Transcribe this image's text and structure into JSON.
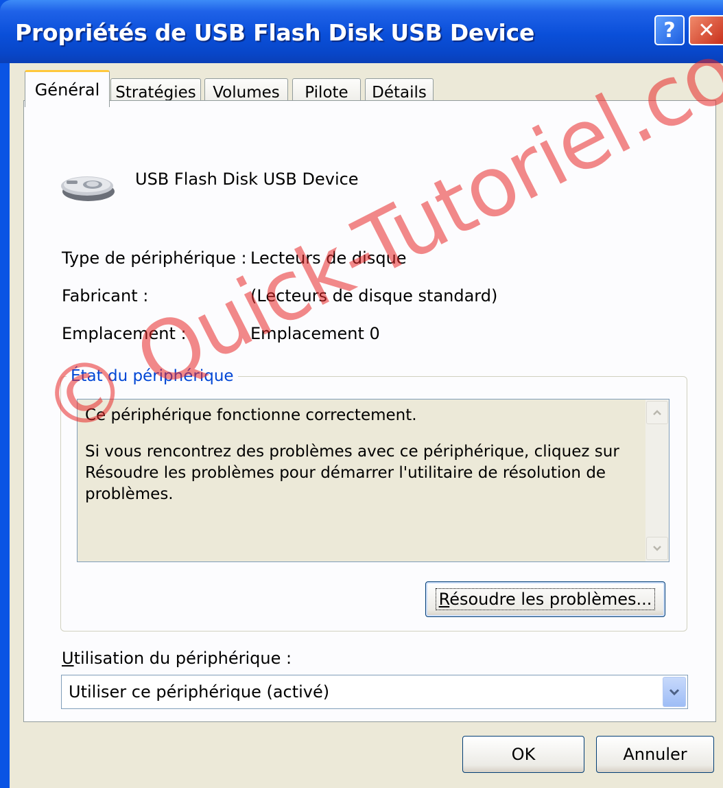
{
  "window": {
    "title": "Propriétés de USB Flash Disk USB Device",
    "help_label": "?",
    "close_label": "✕"
  },
  "tabs": [
    {
      "label": "Général",
      "active": true
    },
    {
      "label": "Stratégies",
      "active": false
    },
    {
      "label": "Volumes",
      "active": false
    },
    {
      "label": "Pilote",
      "active": false
    },
    {
      "label": "Détails",
      "active": false
    }
  ],
  "device": {
    "icon": "disk-drive-icon",
    "name": "USB Flash Disk USB Device"
  },
  "properties": [
    {
      "label": "Type de périphérique :",
      "value": "Lecteurs de disque"
    },
    {
      "label": "Fabricant :",
      "value": "(Lecteurs de disque standard)"
    },
    {
      "label": "Emplacement :",
      "value": "Emplacement 0"
    }
  ],
  "status": {
    "group_title": "État du périphérique",
    "line1": "Ce périphérique fonctionne correctement.",
    "line2": "Si vous rencontrez des problèmes avec ce périphérique, cliquez sur Résoudre les problèmes pour démarrer l'utilitaire de résolution de problèmes.",
    "troubleshoot_button_mnemonic": "R",
    "troubleshoot_button_rest": "ésoudre les problèmes..."
  },
  "usage": {
    "label_mnemonic": "U",
    "label_rest": "tilisation du périphérique :",
    "selected": "Utiliser ce périphérique (activé)"
  },
  "buttons": {
    "ok": "OK",
    "cancel": "Annuler"
  },
  "watermark": "© Quick-Tutoriel.com",
  "colors": {
    "titlebar": "#0a4fd9",
    "dialog_bg": "#ece9d8",
    "group_title": "#0046d5",
    "active_tab_accent": "#ffc83c",
    "watermark": "#e82828"
  }
}
